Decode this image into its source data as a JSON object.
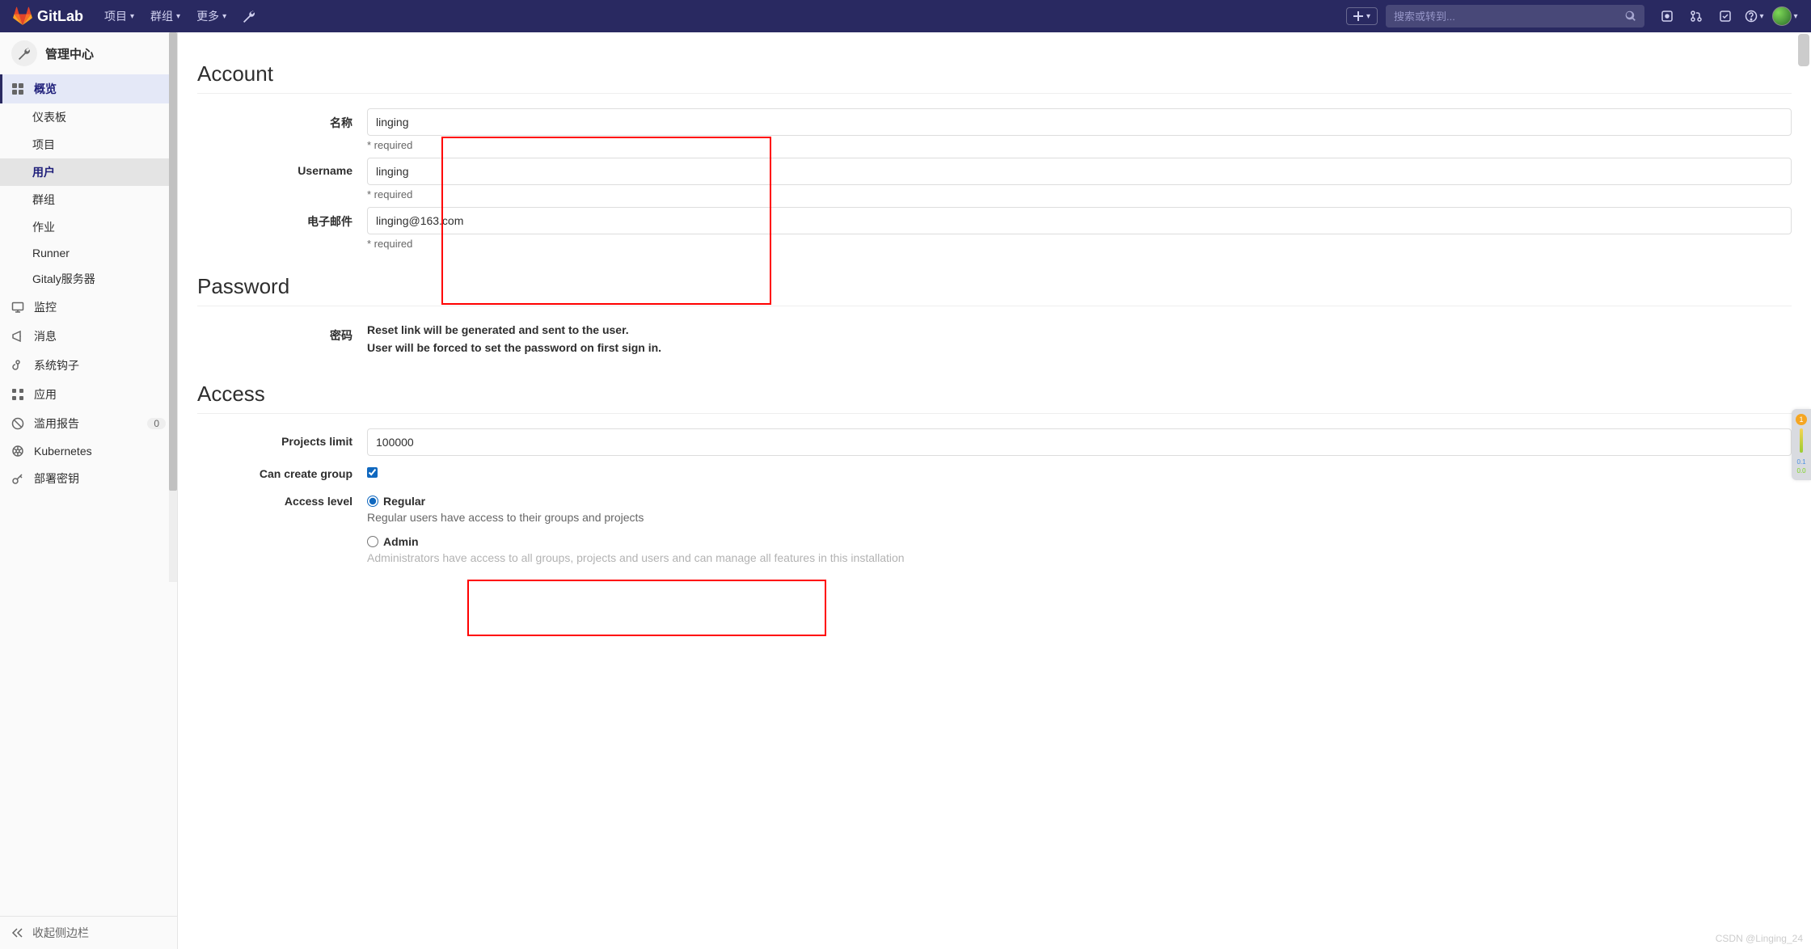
{
  "header": {
    "brand": "GitLab",
    "nav": {
      "projects": "项目",
      "groups": "群组",
      "more": "更多"
    },
    "search_placeholder": "搜索或转到..."
  },
  "sidebar": {
    "title": "管理中心",
    "overview": {
      "label": "概览"
    },
    "sub": {
      "dashboard": "仪表板",
      "projects": "项目",
      "users": "用户",
      "groups": "群组",
      "jobs": "作业",
      "runner": "Runner",
      "gitaly": "Gitaly服务器"
    },
    "monitoring": "监控",
    "messages": "消息",
    "hooks": "系统钩子",
    "apps": "应用",
    "abuse": {
      "label": "滥用报告",
      "count": "0"
    },
    "kubernetes": "Kubernetes",
    "deploy_keys": "部署密钥",
    "collapse": "收起侧边栏"
  },
  "sections": {
    "account": {
      "title": "Account"
    },
    "password": {
      "title": "Password"
    },
    "access": {
      "title": "Access"
    }
  },
  "account": {
    "name_label": "名称",
    "name_value": "linging",
    "name_helper": "* required",
    "username_label": "Username",
    "username_value": "linging",
    "username_helper": "* required",
    "email_label": "电子邮件",
    "email_value": "linging@163.com",
    "email_helper": "* required"
  },
  "password": {
    "label": "密码",
    "line1": "Reset link will be generated and sent to the user.",
    "line2": "User will be forced to set the password on first sign in."
  },
  "access": {
    "projects_limit_label": "Projects limit",
    "projects_limit_value": "100000",
    "can_create_group_label": "Can create group",
    "can_create_group_checked": true,
    "access_level_label": "Access level",
    "regular_label": "Regular",
    "regular_desc": "Regular users have access to their groups and projects",
    "admin_label": "Admin",
    "admin_desc_partial": "Administrators have access to all groups, projects and users and can manage all features in this installation"
  },
  "watermark": "CSDN @Linging_24",
  "gadget": {
    "badge": "1",
    "num1": "0.1",
    "num2": "0.0"
  }
}
